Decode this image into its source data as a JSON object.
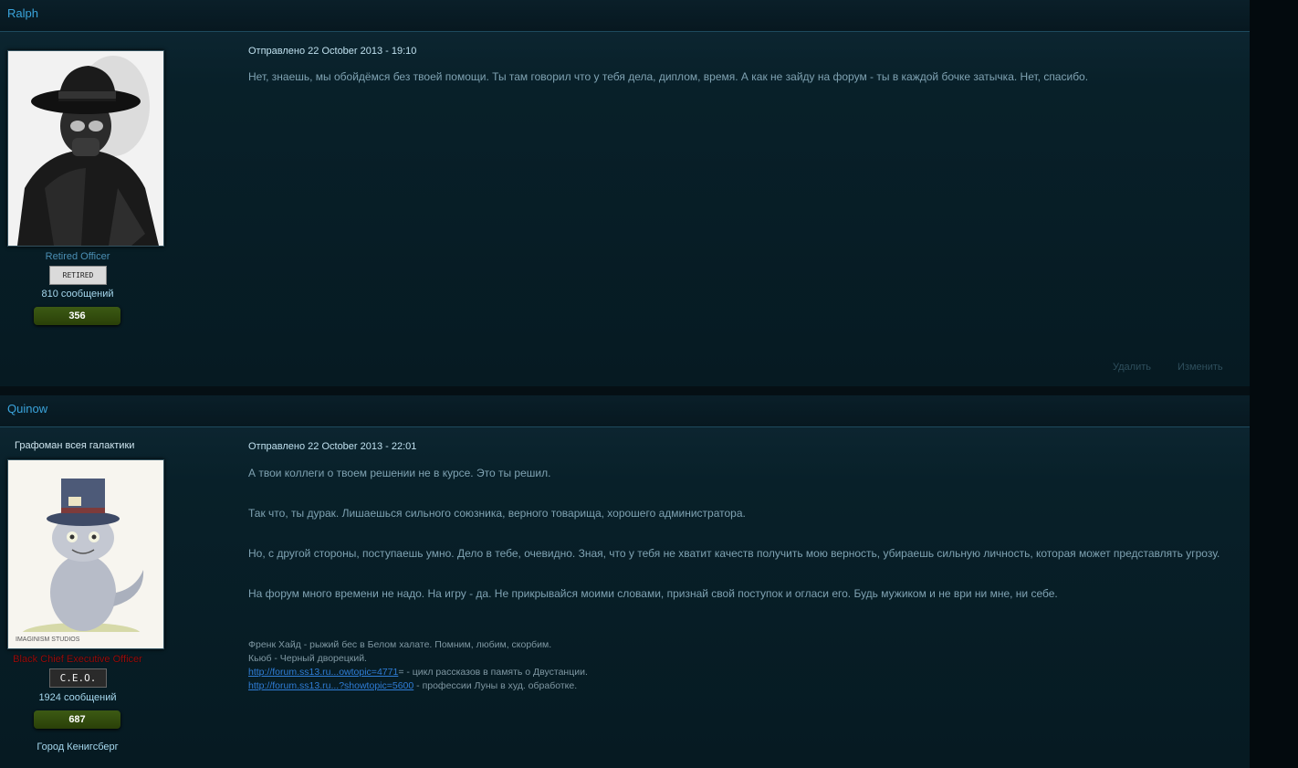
{
  "posts": [
    {
      "author": "Ralph",
      "avatar_alt": "spy-avatar",
      "rank": "Retired Officer",
      "rank_color": "#4b8fb4",
      "rank_badge": "RETIRED",
      "messages": "810 сообщений",
      "reputation": "356",
      "posted": "Отправлено 22 October 2013 - 19:10",
      "paragraphs": [
        "Нет, знаешь, мы обойдёмся без твоей помощи. Ты там говорил что у тебя дела, диплом, время. А как не зайду на форум - ты в каждой бочке затычка. Нет, спасибо."
      ],
      "actions": {
        "delete": "Удалить",
        "edit": "Изменить"
      }
    },
    {
      "author": "Quinow",
      "user_title": "Графоман всея галактики",
      "rank": "Black Chief Executive Officer",
      "rank_color": "#9a0d0d",
      "rank_badge": "C.E.O.",
      "messages": "1924 сообщений",
      "reputation": "687",
      "location": "Город Кенигсберг",
      "posted": "Отправлено 22 October 2013 - 22:01",
      "paragraphs": [
        "А твои коллеги о твоем решении не в курсе. Это ты решил.",
        "Так что, ты дурак. Лишаешься сильного союзника, верного товарища, хорошего администратора.",
        "Но, с другой стороны, поступаешь умно. Дело в тебе, очевидно. Зная, что у тебя не хватит качеств получить мою верность, убираешь сильную личность, которая может представлять угрозу.",
        "На форум много времени не надо. На игру - да. Не прикрывайся моими словами, признай свой поступок и огласи его. Будь мужиком  и не ври ни мне, ни себе."
      ],
      "signature": {
        "line1": "Френк Хайд - рыжий бес в Белом халате. Помним, любим, скорбим.",
        "line2": "Кьюб - Черный дворецкий.",
        "link1": "http://forum.ss13.ru...owtopic=4771",
        "link1_suffix": "= - цикл рассказов в память о Двустанции.",
        "link2": "http://forum.ss13.ru...?showtopic=5600",
        "link2_suffix": " - профессии Луны в худ. обработке."
      },
      "avatar_caption": "IMAGINISM STUDIOS"
    }
  ]
}
